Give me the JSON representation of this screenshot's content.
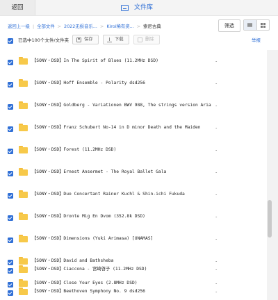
{
  "header": {
    "back_label": "返回",
    "title": "文件库"
  },
  "breadcrumb": {
    "items": [
      "返回上一级",
      "全部文件",
      "2022无损音乐...",
      "Kiroi稀有资...",
      "索尼古典"
    ]
  },
  "controls": {
    "filter_label": "筛选"
  },
  "toolbar": {
    "selected_text": "已选中100个文件/文件夹",
    "save_label": "保存",
    "download_label": "下载",
    "delete_label": "删除",
    "help_label": "举报"
  },
  "files": [
    {
      "name": "【SONY・DSD】In The Spirit of Blues (11.2MHz DSD)",
      "size": "-"
    },
    {
      "name": "【SONY・DSD】Hoff Ensemble - Polarity dsd256",
      "size": "-"
    },
    {
      "name": "【SONY・DSD】Goldberg - Variationen BWV 988, The strings version Aria",
      "size": "-"
    },
    {
      "name": "【SONY・DSD】Franz Schubert No-14 in D minor Death and the Maiden",
      "size": "-"
    },
    {
      "name": "【SONY・DSD】Forest (11.2MHz DSD)",
      "size": "-"
    },
    {
      "name": "【SONY・DSD】Ernest Ansermet - The Royal Ballet Gala",
      "size": "-"
    },
    {
      "name": "【SONY・DSD】Duo Concertant Rainer Kuchl & Shin-ichi Fukuda",
      "size": "-"
    },
    {
      "name": "【SONY・DSD】Dronte Mig En Dvom (352.8k DSD)",
      "size": "-"
    },
    {
      "name": "【SONY・DSD】Dimensions (Yuki Arimasa) [UNAMAS]",
      "size": "-"
    },
    {
      "name": "【SONY・DSD】David and Bathsheba",
      "size": "-"
    },
    {
      "name": "【SONY・DSD】Close Your Eyes (2.8MHz DSD)",
      "size": "-"
    },
    {
      "name": "【SONY・DSD】Ciaccona - 宮崎啓子 (11.2MHz DSD)",
      "size": "-"
    },
    {
      "name": "【SONY・DSD】Beethoven Symphony No. 9 dsd256",
      "size": "-"
    }
  ],
  "colors": {
    "accent": "#2f6fd6",
    "folder": "#f7c94a"
  },
  "icons": {
    "title": "tv-icon",
    "folder": "folder-icon",
    "list_view": "list-view-icon",
    "grid_view": "grid-view-icon"
  }
}
